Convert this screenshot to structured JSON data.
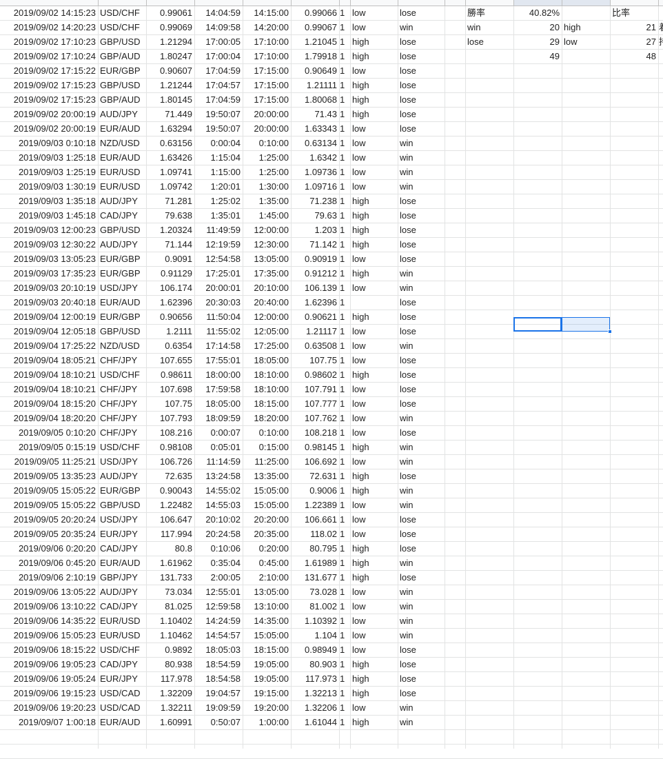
{
  "colors": {
    "grid": "#e2e3e3",
    "header": "#f8f9fa",
    "selection": "#1a73e8",
    "text": "#222222"
  },
  "summary": {
    "win_rate_label": "勝率",
    "win_rate_value": "40.82%",
    "ratio_label": "比率",
    "win_label": "win",
    "win_count": "20",
    "high_label": "high",
    "high_count": "21",
    "lose_label": "lose",
    "lose_count": "29",
    "low_label": "low",
    "low_count": "27",
    "total_count": "49",
    "hl_total": "48",
    "row2_clip": "着",
    "row3_clip": "持"
  },
  "trades": [
    [
      "2019/09/02 14:15:23",
      "USD/CHF",
      "0.99061",
      "14:04:59",
      "14:15:00",
      "0.99066",
      "1",
      "low",
      "lose"
    ],
    [
      "2019/09/02 14:20:23",
      "USD/CHF",
      "0.99069",
      "14:09:58",
      "14:20:00",
      "0.99067",
      "1",
      "low",
      "win"
    ],
    [
      "2019/09/02 17:10:23",
      "GBP/USD",
      "1.21294",
      "17:00:05",
      "17:10:00",
      "1.21045",
      "1",
      "high",
      "lose"
    ],
    [
      "2019/09/02 17:10:24",
      "GBP/AUD",
      "1.80247",
      "17:00:04",
      "17:10:00",
      "1.79918",
      "1",
      "high",
      "lose"
    ],
    [
      "2019/09/02 17:15:22",
      "EUR/GBP",
      "0.90607",
      "17:04:59",
      "17:15:00",
      "0.90649",
      "1",
      "low",
      "lose"
    ],
    [
      "2019/09/02 17:15:23",
      "GBP/USD",
      "1.21244",
      "17:04:57",
      "17:15:00",
      "1.21111",
      "1",
      "high",
      "lose"
    ],
    [
      "2019/09/02 17:15:23",
      "GBP/AUD",
      "1.80145",
      "17:04:59",
      "17:15:00",
      "1.80068",
      "1",
      "high",
      "lose"
    ],
    [
      "2019/09/02 20:00:19",
      "AUD/JPY",
      "71.449",
      "19:50:07",
      "20:00:00",
      "71.43",
      "1",
      "high",
      "lose"
    ],
    [
      "2019/09/02 20:00:19",
      "EUR/AUD",
      "1.63294",
      "19:50:07",
      "20:00:00",
      "1.63343",
      "1",
      "low",
      "lose"
    ],
    [
      "2019/09/03 0:10:18",
      "NZD/USD",
      "0.63156",
      "0:00:04",
      "0:10:00",
      "0.63134",
      "1",
      "low",
      "win"
    ],
    [
      "2019/09/03 1:25:18",
      "EUR/AUD",
      "1.63426",
      "1:15:04",
      "1:25:00",
      "1.6342",
      "1",
      "low",
      "win"
    ],
    [
      "2019/09/03 1:25:19",
      "EUR/USD",
      "1.09741",
      "1:15:00",
      "1:25:00",
      "1.09736",
      "1",
      "low",
      "win"
    ],
    [
      "2019/09/03 1:30:19",
      "EUR/USD",
      "1.09742",
      "1:20:01",
      "1:30:00",
      "1.09716",
      "1",
      "low",
      "win"
    ],
    [
      "2019/09/03 1:35:18",
      "AUD/JPY",
      "71.281",
      "1:25:02",
      "1:35:00",
      "71.238",
      "1",
      "high",
      "lose"
    ],
    [
      "2019/09/03 1:45:18",
      "CAD/JPY",
      "79.638",
      "1:35:01",
      "1:45:00",
      "79.63",
      "1",
      "high",
      "lose"
    ],
    [
      "2019/09/03 12:00:23",
      "GBP/USD",
      "1.20324",
      "11:49:59",
      "12:00:00",
      "1.203",
      "1",
      "high",
      "lose"
    ],
    [
      "2019/09/03 12:30:22",
      "AUD/JPY",
      "71.144",
      "12:19:59",
      "12:30:00",
      "71.142",
      "1",
      "high",
      "lose"
    ],
    [
      "2019/09/03 13:05:23",
      "EUR/GBP",
      "0.9091",
      "12:54:58",
      "13:05:00",
      "0.90919",
      "1",
      "low",
      "lose"
    ],
    [
      "2019/09/03 17:35:23",
      "EUR/GBP",
      "0.91129",
      "17:25:01",
      "17:35:00",
      "0.91212",
      "1",
      "high",
      "win"
    ],
    [
      "2019/09/03 20:10:19",
      "USD/JPY",
      "106.174",
      "20:00:01",
      "20:10:00",
      "106.139",
      "1",
      "low",
      "win"
    ],
    [
      "2019/09/03 20:40:18",
      "EUR/AUD",
      "1.62396",
      "20:30:03",
      "20:40:00",
      "1.62396",
      "1",
      "",
      "lose"
    ],
    [
      "2019/09/04 12:00:19",
      "EUR/GBP",
      "0.90656",
      "11:50:04",
      "12:00:00",
      "0.90621",
      "1",
      "high",
      "lose"
    ],
    [
      "2019/09/04 12:05:18",
      "GBP/USD",
      "1.2111",
      "11:55:02",
      "12:05:00",
      "1.21117",
      "1",
      "low",
      "lose"
    ],
    [
      "2019/09/04 17:25:22",
      "NZD/USD",
      "0.6354",
      "17:14:58",
      "17:25:00",
      "0.63508",
      "1",
      "low",
      "win"
    ],
    [
      "2019/09/04 18:05:21",
      "CHF/JPY",
      "107.655",
      "17:55:01",
      "18:05:00",
      "107.75",
      "1",
      "low",
      "lose"
    ],
    [
      "2019/09/04 18:10:21",
      "USD/CHF",
      "0.98611",
      "18:00:00",
      "18:10:00",
      "0.98602",
      "1",
      "high",
      "lose"
    ],
    [
      "2019/09/04 18:10:21",
      "CHF/JPY",
      "107.698",
      "17:59:58",
      "18:10:00",
      "107.791",
      "1",
      "low",
      "lose"
    ],
    [
      "2019/09/04 18:15:20",
      "CHF/JPY",
      "107.75",
      "18:05:00",
      "18:15:00",
      "107.777",
      "1",
      "low",
      "lose"
    ],
    [
      "2019/09/04 18:20:20",
      "CHF/JPY",
      "107.793",
      "18:09:59",
      "18:20:00",
      "107.762",
      "1",
      "low",
      "win"
    ],
    [
      "2019/09/05 0:10:20",
      "CHF/JPY",
      "108.216",
      "0:00:07",
      "0:10:00",
      "108.218",
      "1",
      "low",
      "lose"
    ],
    [
      "2019/09/05 0:15:19",
      "USD/CHF",
      "0.98108",
      "0:05:01",
      "0:15:00",
      "0.98145",
      "1",
      "high",
      "win"
    ],
    [
      "2019/09/05 11:25:21",
      "USD/JPY",
      "106.726",
      "11:14:59",
      "11:25:00",
      "106.692",
      "1",
      "low",
      "win"
    ],
    [
      "2019/09/05 13:35:23",
      "AUD/JPY",
      "72.635",
      "13:24:58",
      "13:35:00",
      "72.631",
      "1",
      "high",
      "lose"
    ],
    [
      "2019/09/05 15:05:22",
      "EUR/GBP",
      "0.90043",
      "14:55:02",
      "15:05:00",
      "0.9006",
      "1",
      "high",
      "win"
    ],
    [
      "2019/09/05 15:05:22",
      "GBP/USD",
      "1.22482",
      "14:55:03",
      "15:05:00",
      "1.22389",
      "1",
      "low",
      "win"
    ],
    [
      "2019/09/05 20:20:24",
      "USD/JPY",
      "106.647",
      "20:10:02",
      "20:20:00",
      "106.661",
      "1",
      "low",
      "lose"
    ],
    [
      "2019/09/05 20:35:24",
      "EUR/JPY",
      "117.994",
      "20:24:58",
      "20:35:00",
      "118.02",
      "1",
      "low",
      "lose"
    ],
    [
      "2019/09/06 0:20:20",
      "CAD/JPY",
      "80.8",
      "0:10:06",
      "0:20:00",
      "80.795",
      "1",
      "high",
      "lose"
    ],
    [
      "2019/09/06 0:45:20",
      "EUR/AUD",
      "1.61962",
      "0:35:04",
      "0:45:00",
      "1.61989",
      "1",
      "high",
      "win"
    ],
    [
      "2019/09/06 2:10:19",
      "GBP/JPY",
      "131.733",
      "2:00:05",
      "2:10:00",
      "131.677",
      "1",
      "high",
      "lose"
    ],
    [
      "2019/09/06 13:05:22",
      "AUD/JPY",
      "73.034",
      "12:55:01",
      "13:05:00",
      "73.028",
      "1",
      "low",
      "win"
    ],
    [
      "2019/09/06 13:10:22",
      "CAD/JPY",
      "81.025",
      "12:59:58",
      "13:10:00",
      "81.002",
      "1",
      "low",
      "win"
    ],
    [
      "2019/09/06 14:35:22",
      "EUR/USD",
      "1.10402",
      "14:24:59",
      "14:35:00",
      "1.10392",
      "1",
      "low",
      "win"
    ],
    [
      "2019/09/06 15:05:23",
      "EUR/USD",
      "1.10462",
      "14:54:57",
      "15:05:00",
      "1.104",
      "1",
      "low",
      "win"
    ],
    [
      "2019/09/06 18:15:22",
      "USD/CHF",
      "0.9892",
      "18:05:03",
      "18:15:00",
      "0.98949",
      "1",
      "low",
      "lose"
    ],
    [
      "2019/09/06 19:05:23",
      "CAD/JPY",
      "80.938",
      "18:54:59",
      "19:05:00",
      "80.903",
      "1",
      "high",
      "lose"
    ],
    [
      "2019/09/06 19:05:24",
      "EUR/JPY",
      "117.978",
      "18:54:58",
      "19:05:00",
      "117.973",
      "1",
      "high",
      "lose"
    ],
    [
      "2019/09/06 19:15:23",
      "USD/CAD",
      "1.32209",
      "19:04:57",
      "19:15:00",
      "1.32213",
      "1",
      "high",
      "lose"
    ],
    [
      "2019/09/06 19:20:23",
      "USD/CAD",
      "1.32211",
      "19:09:59",
      "19:20:00",
      "1.32206",
      "1",
      "low",
      "win"
    ],
    [
      "2019/09/07 1:00:18",
      "EUR/AUD",
      "1.60991",
      "0:50:07",
      "1:00:00",
      "1.61044",
      "1",
      "high",
      "win"
    ]
  ]
}
